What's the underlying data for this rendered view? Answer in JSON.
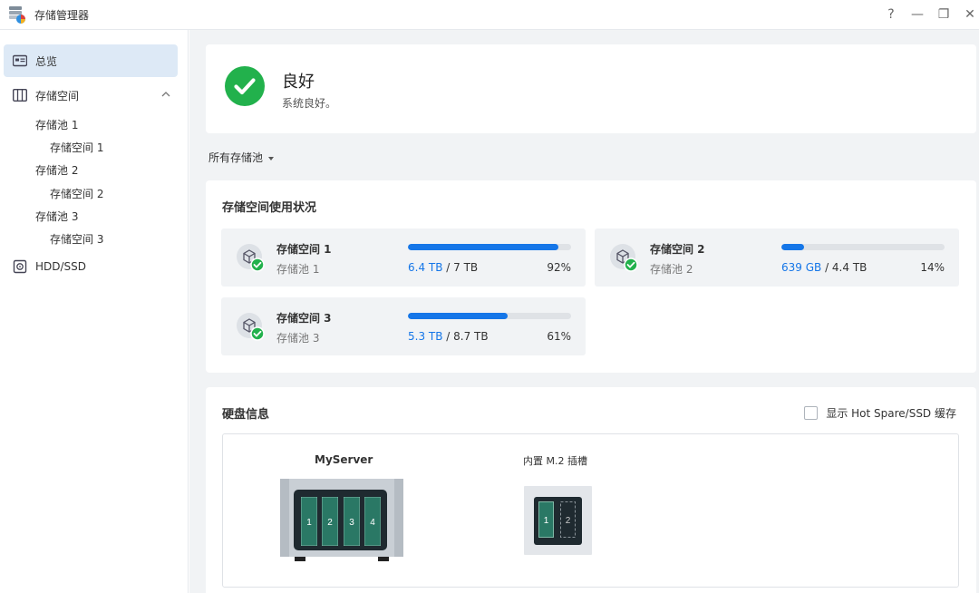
{
  "window": {
    "title": "存储管理器",
    "buttons": {
      "help": "?",
      "minimize": "—",
      "restore": "❐",
      "close": "✕"
    }
  },
  "sidebar": {
    "overview": "总览",
    "storage": "存储空间",
    "pools": [
      {
        "pool": "存储池 1",
        "volume": "存储空间 1"
      },
      {
        "pool": "存储池 2",
        "volume": "存储空间 2"
      },
      {
        "pool": "存储池 3",
        "volume": "存储空间 3"
      }
    ],
    "hdd": "HDD/SSD"
  },
  "status": {
    "title": "良好",
    "subtitle": "系统良好。",
    "color": "#22b14c"
  },
  "filter": {
    "label": "所有存储池"
  },
  "usage": {
    "title": "存储空间使用状况",
    "accent": "#1576e8",
    "volumes": [
      {
        "name": "存储空间 1",
        "pool": "存储池 1",
        "used": "6.4 TB",
        "total": " / 7 TB",
        "percent_label": "92%",
        "percent": 92
      },
      {
        "name": "存储空间 2",
        "pool": "存储池 2",
        "used": "639 GB",
        "total": " / 4.4 TB",
        "percent_label": "14%",
        "percent": 14
      },
      {
        "name": "存储空间 3",
        "pool": "存储池 3",
        "used": "5.3 TB",
        "total": " / 8.7 TB",
        "percent_label": "61%",
        "percent": 61
      }
    ]
  },
  "disks": {
    "title": "硬盘信息",
    "hotspare_label": "显示 Hot Spare/SSD 缓存",
    "hotspare_checked": false,
    "server_name": "MyServer",
    "bays": [
      "1",
      "2",
      "3",
      "4"
    ],
    "m2_title": "内置 M.2 插槽",
    "m2_slots": [
      "1",
      "2"
    ]
  }
}
